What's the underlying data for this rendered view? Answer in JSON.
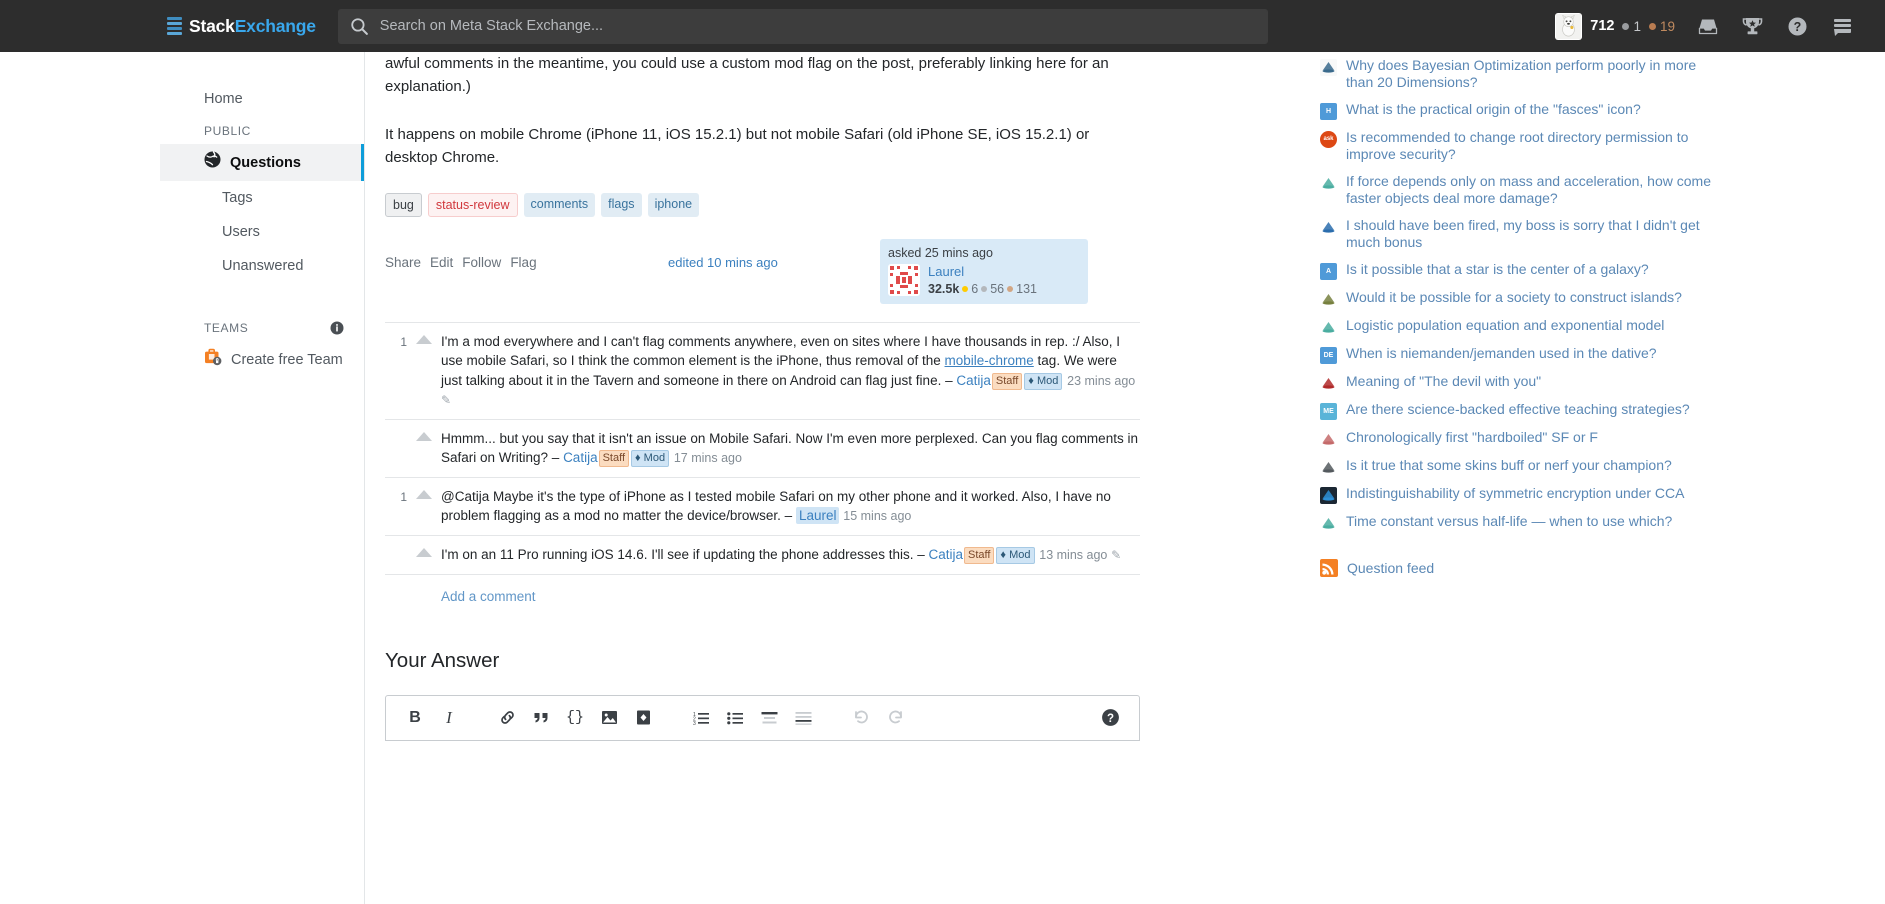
{
  "topbar": {
    "logo_stack": "stack-logo",
    "logo_text_a": "Stack",
    "logo_text_b": "Exchange",
    "search_placeholder": "Search on Meta Stack Exchange...",
    "search_value": "",
    "reputation": "712",
    "silver_count": "1",
    "bronze_count": "19",
    "icons": [
      "inbox-icon",
      "achievements-trophy-icon",
      "help-icon",
      "site-switcher-icon"
    ]
  },
  "sidebar": {
    "home_label": "Home",
    "public_header": "PUBLIC",
    "items": [
      {
        "label": "Questions",
        "icon": "globe-icon",
        "active": true
      },
      {
        "label": "Tags",
        "active": false
      },
      {
        "label": "Users",
        "active": false
      },
      {
        "label": "Unanswered",
        "active": false
      }
    ],
    "teams_header": "TEAMS",
    "teams_info_icon": "info-icon",
    "create_team_label": "Create free Team",
    "create_team_icon": "briefcase-lock-icon"
  },
  "post": {
    "paragraphs": [
      "awful comments in the meantime, you could use a custom mod flag on the post, preferably linking here for an explanation.)",
      "It happens on mobile Chrome (iPhone 11, iOS 15.2.1) but not mobile Safari (old iPhone SE, iOS 15.2.1) or desktop Chrome."
    ],
    "tags": [
      {
        "name": "bug",
        "style": "req"
      },
      {
        "name": "status-review",
        "style": "status"
      },
      {
        "name": "comments",
        "style": "normal"
      },
      {
        "name": "flags",
        "style": "normal"
      },
      {
        "name": "iphone",
        "style": "normal"
      }
    ],
    "actions": [
      "Share",
      "Edit",
      "Follow",
      "Flag"
    ],
    "edited_label": "edited 10 mins ago",
    "asked_label": "asked 25 mins ago",
    "author": {
      "name": "Laurel",
      "reputation": "32.5k",
      "gold": "6",
      "silver": "56",
      "bronze": "131"
    }
  },
  "comments": [
    {
      "score": "1",
      "text_1": "I'm a mod everywhere and I can't flag comments anywhere, even on sites where I have thousands in rep. :/ Also, I use mobile Safari, so I think the common element is the iPhone, thus removal of the ",
      "link": "mobile-chrome",
      "text_2": " tag. We were just talking about it in the Tavern and someone in there on Android can flag just fine. – ",
      "user": "Catija",
      "user_highlight": false,
      "staff": "Staff",
      "mod": "♦ Mod",
      "date": "23 mins ago",
      "editable": true
    },
    {
      "score": "",
      "text_1": "Hmmm... but you say that it isn't an issue on Mobile Safari. Now I'm even more perplexed. Can you flag comments in Safari on Writing? – ",
      "link": "",
      "text_2": "",
      "user": "Catija",
      "user_highlight": false,
      "staff": "Staff",
      "mod": "♦ Mod",
      "date": "17 mins ago",
      "editable": false
    },
    {
      "score": "1",
      "text_1": "@Catija Maybe it's the type of iPhone as I tested mobile Safari on my other phone and it worked. Also, I have no problem flagging as a mod no matter the device/browser. – ",
      "link": "",
      "text_2": "",
      "user": "Laurel",
      "user_highlight": true,
      "staff": "",
      "mod": "",
      "date": "15 mins ago",
      "editable": false
    },
    {
      "score": "",
      "text_1": "I'm on an 11 Pro running iOS 14.6. I'll see if updating the phone addresses this. – ",
      "link": "",
      "text_2": "",
      "user": "Catija",
      "user_highlight": false,
      "staff": "Staff",
      "mod": "♦ Mod",
      "date": "13 mins ago",
      "editable": true
    }
  ],
  "add_comment_label": "Add a comment",
  "your_answer_title": "Your Answer",
  "editor_toolbar": [
    {
      "name": "bold-icon",
      "glyph": "B"
    },
    {
      "name": "italic-icon",
      "glyph": "I"
    },
    {
      "name": "link-icon",
      "glyph": "🔗"
    },
    {
      "name": "blockquote-icon",
      "glyph": "❞"
    },
    {
      "name": "inline-code-icon",
      "glyph": "{}"
    },
    {
      "name": "image-icon",
      "glyph": "🖼"
    },
    {
      "name": "code-block-icon",
      "glyph": "◇"
    },
    {
      "name": "numbered-list-icon",
      "glyph": "1≡"
    },
    {
      "name": "bulleted-list-icon",
      "glyph": "≔"
    },
    {
      "name": "heading-icon",
      "glyph": "≡"
    },
    {
      "name": "horizontal-rule-icon",
      "glyph": "☰"
    },
    {
      "name": "undo-icon",
      "glyph": "↶"
    },
    {
      "name": "redo-icon",
      "glyph": "↷"
    },
    {
      "name": "help-icon",
      "glyph": "?"
    }
  ],
  "hot_network": {
    "items": [
      {
        "text": "Why does Bayesian Optimization perform poorly in more than 20 Dimensions?",
        "icon": "crossvalidated-icon",
        "icon_bg": "#f8f9f9",
        "icon_fg": "#3a6a8c",
        "label": ""
      },
      {
        "text": "What is the practical origin of the \"fasces\" icon?",
        "icon": "history-se-icon",
        "icon_bg": "#4f9ad8",
        "icon_fg": "#ffffff",
        "label": "H"
      },
      {
        "text": "Is recommended to change root directory permission to improve security?",
        "icon": "askubuntu-icon",
        "icon_bg": "#dd4814",
        "icon_fg": "#ffffff",
        "label": "ask"
      },
      {
        "text": "If force depends only on mass and acceleration, how come faster objects deal more damage?",
        "icon": "physics-se-icon",
        "icon_bg": "#ffffff",
        "icon_fg": "#4aada0",
        "label": ""
      },
      {
        "text": "I should have been fired, my boss is sorry that I didn't get much bonus",
        "icon": "workplace-se-icon",
        "icon_bg": "#ffffff",
        "icon_fg": "#2b6dad",
        "label": ""
      },
      {
        "text": "Is it possible that a star is the center of a galaxy?",
        "icon": "astronomy-se-icon",
        "icon_bg": "#4f9ad8",
        "icon_fg": "#ffffff",
        "label": "A"
      },
      {
        "text": "Would it be possible for a society to construct islands?",
        "icon": "worldbuilding-se-icon",
        "icon_bg": "#ffffff",
        "icon_fg": "#77803f",
        "label": ""
      },
      {
        "text": "Logistic population equation and exponential model",
        "icon": "mathematics-se-icon",
        "icon_bg": "#ffffff",
        "icon_fg": "#4aada0",
        "label": ""
      },
      {
        "text": "When is niemanden/jemanden used in the dative?",
        "icon": "german-se-icon",
        "icon_bg": "#4f9ad8",
        "icon_fg": "#ffffff",
        "label": "DE"
      },
      {
        "text": "Meaning of \"The devil with you\"",
        "icon": "english-se-icon",
        "icon_bg": "#ffffff",
        "icon_fg": "#b02a2a",
        "label": ""
      },
      {
        "text": "Are there science-backed effective teaching strategies?",
        "icon": "matheducators-se-icon",
        "icon_bg": "#5ab4d8",
        "icon_fg": "#ffffff",
        "label": "ME"
      },
      {
        "text": "Chronologically first \"hardboiled\" SF or F",
        "icon": "scifi-se-icon",
        "icon_bg": "#ffffff",
        "icon_fg": "#c46a6a",
        "label": ""
      },
      {
        "text": "Is it true that some skins buff or nerf your champion?",
        "icon": "gaming-se-icon",
        "icon_bg": "#ffffff",
        "icon_fg": "#545a5e",
        "label": ""
      },
      {
        "text": "Indistinguishability of symmetric encryption under CCA",
        "icon": "crypto-se-icon",
        "icon_bg": "#1b2733",
        "icon_fg": "#2d8fd5",
        "label": ""
      },
      {
        "text": "Time constant versus half-life — when to use which?",
        "icon": "physics-se-icon",
        "icon_bg": "#ffffff",
        "icon_fg": "#4aada0",
        "label": ""
      }
    ],
    "feed_label": "Question feed",
    "feed_icon": "rss-icon"
  },
  "colors": {
    "topbar_bg": "#2d2d2d",
    "accent_blue": "#0d9dda",
    "link_blue": "#3b80bf",
    "tag_bg": "#e1ecf4",
    "tag_fg": "#39739d",
    "usercard_bg": "#d9eaf7",
    "orange": "#f48024"
  }
}
